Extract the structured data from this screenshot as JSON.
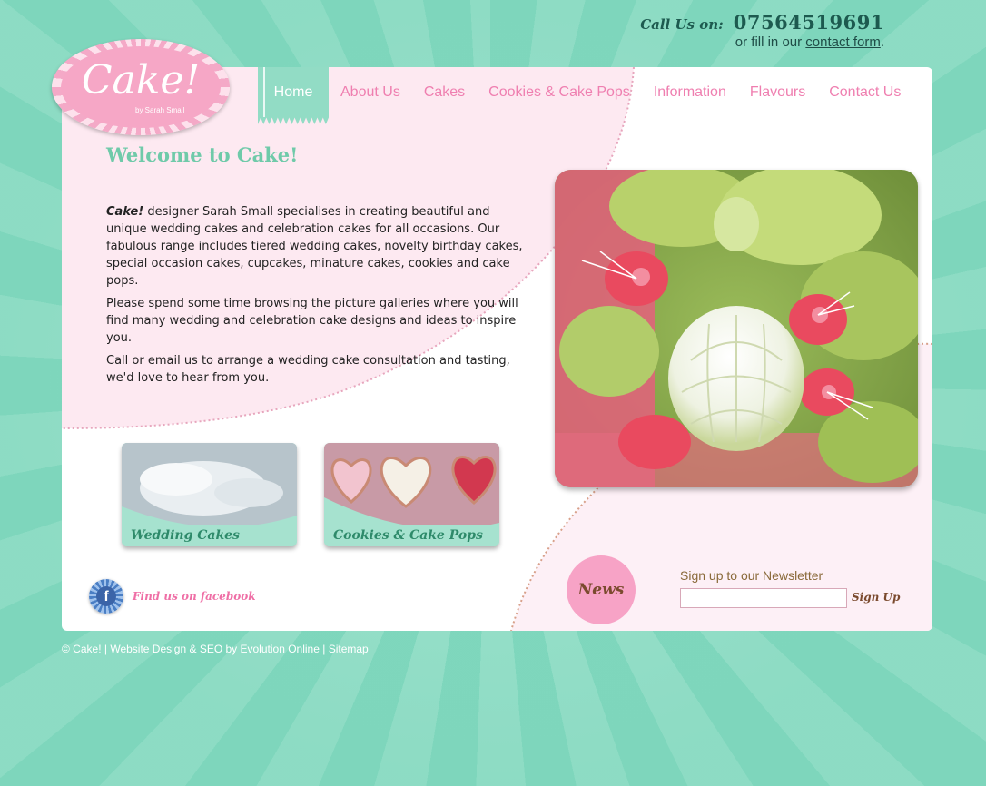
{
  "header": {
    "call_label": "Call Us on:",
    "phone": "07564519691",
    "contact_prefix": "or fill in our",
    "contact_link": "contact form",
    "contact_suffix": "."
  },
  "logo": {
    "name": "Cake!",
    "byline": "by Sarah Small"
  },
  "nav": {
    "items": [
      "Home",
      "About Us",
      "Cakes",
      "Cookies & Cake Pops",
      "Information",
      "Flavours",
      "Contact Us"
    ],
    "active": "Home"
  },
  "main": {
    "title": "Welcome to Cake!",
    "brand": "Cake!",
    "p1_rest": " designer Sarah Small specialises in creating beautiful and unique wedding cakes and celebration cakes for all occasions. Our fabulous range includes tiered wedding cakes, novelty birthday cakes, special occasion cakes, cupcakes, minature cakes, cookies and cake pops.",
    "p2": "Please spend some time browsing the picture galleries where you will find many wedding and celebration cake designs and ideas to inspire you.",
    "p3": "Call or email us to arrange a wedding cake consultation and tasting, we'd love to hear from you."
  },
  "tiles": [
    {
      "label": "Wedding Cakes"
    },
    {
      "label": "Cookies & Cake Pops"
    }
  ],
  "facebook": {
    "icon_letter": "f",
    "label": "Find us on facebook"
  },
  "news": {
    "label": "News"
  },
  "newsletter": {
    "label": "Sign up to our Newsletter",
    "value": "",
    "button": "Sign Up"
  },
  "footer": {
    "copyright": "© Cake!",
    "sep1": " | ",
    "design": "Website Design & SEO by Evolution Online",
    "sep2": " | ",
    "sitemap": "Sitemap"
  },
  "colors": {
    "mint": "#92dcc5",
    "pink": "#ef7fb0",
    "pink_bg": "#fde9f1",
    "brown": "#7b4a2e"
  }
}
